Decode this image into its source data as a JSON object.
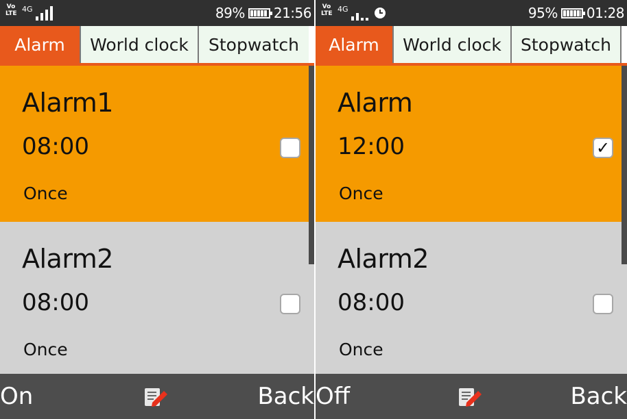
{
  "screens": [
    {
      "status": {
        "network": "4G",
        "volte": "Vo LTE",
        "battery": "89%",
        "battery_level": 0.89,
        "time": "21:56"
      },
      "tabs": [
        "Alarm",
        "World clock",
        "Stopwatch"
      ],
      "active_tab": "Alarm",
      "alarms": [
        {
          "name": "Alarm1",
          "time": "08:00",
          "repeat": "Once",
          "checked": false,
          "selected": true
        },
        {
          "name": "Alarm2",
          "time": "08:00",
          "repeat": "Once",
          "checked": false,
          "selected": false
        }
      ],
      "softkeys": {
        "left": "On",
        "center_icon": "edit-icon",
        "right": "Back"
      }
    },
    {
      "status": {
        "network": "4G",
        "volte": "Vo LTE",
        "battery": "95%",
        "battery_level": 0.95,
        "time": "01:28",
        "alarm_icon": "alarm-clock-icon"
      },
      "tabs": [
        "Alarm",
        "World clock",
        "Stopwatch"
      ],
      "active_tab": "Alarm",
      "alarms": [
        {
          "name": "Alarm",
          "time": "12:00",
          "repeat": "Once",
          "checked": true,
          "check_mark": "✓",
          "selected": true
        },
        {
          "name": "Alarm2",
          "time": "08:00",
          "repeat": "Once",
          "checked": false,
          "selected": false
        }
      ],
      "softkeys": {
        "left": "Off",
        "center_icon": "edit-icon",
        "right": "Back"
      }
    }
  ],
  "colors": {
    "accent": "#e8591c",
    "selected_item": "#f59a00",
    "list_bg": "#d2d2d2",
    "status_bar": "#303030",
    "softkey_bar": "#4d4d4d"
  }
}
